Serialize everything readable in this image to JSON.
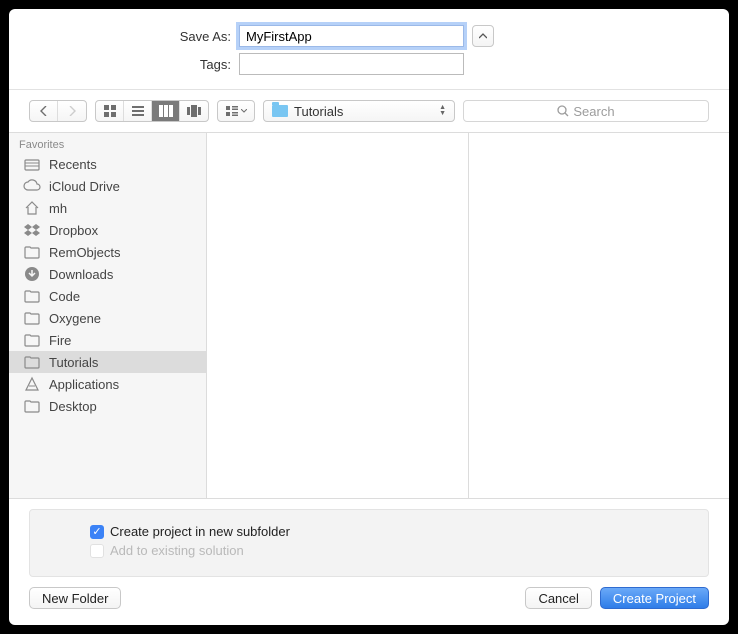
{
  "form": {
    "save_as_label": "Save As:",
    "save_as_value": "MyFirstApp",
    "tags_label": "Tags:",
    "tags_value": ""
  },
  "toolbar": {
    "path_label": "Tutorials",
    "search_placeholder": "Search"
  },
  "sidebar": {
    "header": "Favorites",
    "items": [
      {
        "label": "Recents",
        "icon": "recents-icon"
      },
      {
        "label": "iCloud Drive",
        "icon": "cloud-icon"
      },
      {
        "label": "mh",
        "icon": "home-icon"
      },
      {
        "label": "Dropbox",
        "icon": "dropbox-icon"
      },
      {
        "label": "RemObjects",
        "icon": "folder-icon"
      },
      {
        "label": "Downloads",
        "icon": "downloads-icon"
      },
      {
        "label": "Code",
        "icon": "folder-icon"
      },
      {
        "label": "Oxygene",
        "icon": "folder-icon"
      },
      {
        "label": "Fire",
        "icon": "folder-icon"
      },
      {
        "label": "Tutorials",
        "icon": "folder-icon",
        "selected": true
      },
      {
        "label": "Applications",
        "icon": "applications-icon"
      },
      {
        "label": "Desktop",
        "icon": "folder-icon"
      }
    ]
  },
  "options": {
    "create_subfolder_label": "Create project in new subfolder",
    "create_subfolder_checked": true,
    "add_existing_label": "Add to existing solution",
    "add_existing_checked": false,
    "add_existing_enabled": false
  },
  "footer": {
    "new_folder_label": "New Folder",
    "cancel_label": "Cancel",
    "create_label": "Create Project"
  }
}
